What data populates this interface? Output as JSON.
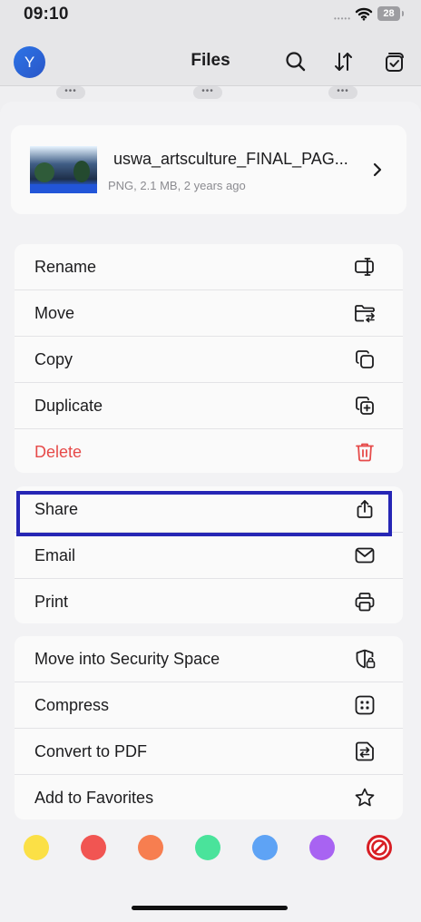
{
  "status_bar": {
    "time": "09:10",
    "signal_dots": "•••••",
    "battery": "28"
  },
  "nav": {
    "avatar_letter": "Y",
    "title": "Files",
    "icons": [
      "search-icon",
      "sort-icon",
      "select-icon"
    ]
  },
  "background": {
    "more_dots": "•••"
  },
  "file": {
    "name": "uswa_artsculture_FINAL_PAG...",
    "meta": "PNG, 2.1 MB, 2 years ago"
  },
  "actions": {
    "group1": [
      {
        "label": "Rename",
        "icon": "rename-icon"
      },
      {
        "label": "Move",
        "icon": "move-folder-icon"
      },
      {
        "label": "Copy",
        "icon": "copy-icon"
      },
      {
        "label": "Duplicate",
        "icon": "duplicate-icon"
      },
      {
        "label": "Delete",
        "icon": "trash-icon"
      }
    ],
    "group2": [
      {
        "label": "Share",
        "icon": "share-icon"
      },
      {
        "label": "Email",
        "icon": "email-icon"
      },
      {
        "label": "Print",
        "icon": "print-icon"
      }
    ],
    "group3": [
      {
        "label": "Move into Security Space",
        "icon": "security-space-icon"
      },
      {
        "label": "Compress",
        "icon": "compress-icon"
      },
      {
        "label": "Convert to PDF",
        "icon": "convert-icon"
      },
      {
        "label": "Add to Favorites",
        "icon": "star-icon"
      }
    ]
  },
  "color_tags": [
    "#fbe046",
    "#f15552",
    "#f77e50",
    "#4ae39b",
    "#5ea3f5",
    "#a863f2"
  ],
  "colors": {
    "danger": "#e64a49",
    "highlight": "#2626b5",
    "no_color": "#d81e24"
  }
}
